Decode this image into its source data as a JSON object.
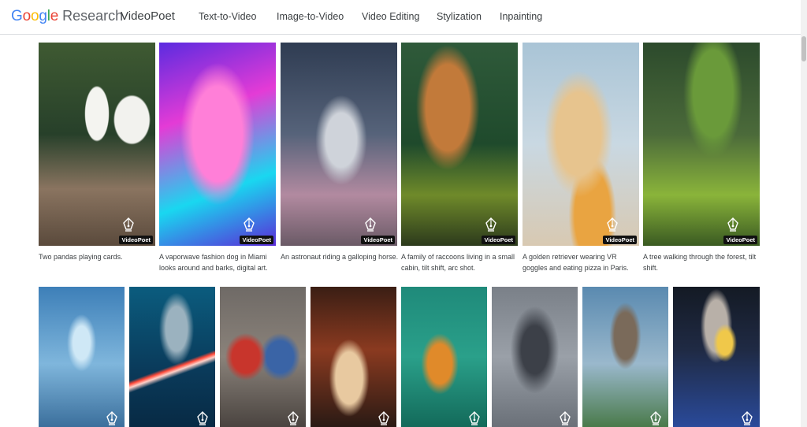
{
  "header": {
    "brand_google": "Google",
    "brand_research": "Research",
    "product": "VideoPoet",
    "nav": [
      "Text-to-Video",
      "Image-to-Video",
      "Video Editing",
      "Stylization",
      "Inpainting"
    ]
  },
  "badge_label": "VideoPoet",
  "row1": [
    {
      "caption": "Two pandas playing cards."
    },
    {
      "caption": "A vaporwave fashion dog in Miami looks around and barks, digital art."
    },
    {
      "caption": "An astronaut riding a galloping horse."
    },
    {
      "caption": "A family of raccoons living in a small cabin, tilt shift, arc shot."
    },
    {
      "caption": "A golden retriever wearing VR goggles and eating pizza in Paris."
    },
    {
      "caption": "A tree walking through the forest, tilt shift."
    }
  ],
  "colors": {
    "google_blue": "#4285F4",
    "google_red": "#EA4335",
    "google_yellow": "#FBBC05",
    "google_green": "#34A853"
  }
}
